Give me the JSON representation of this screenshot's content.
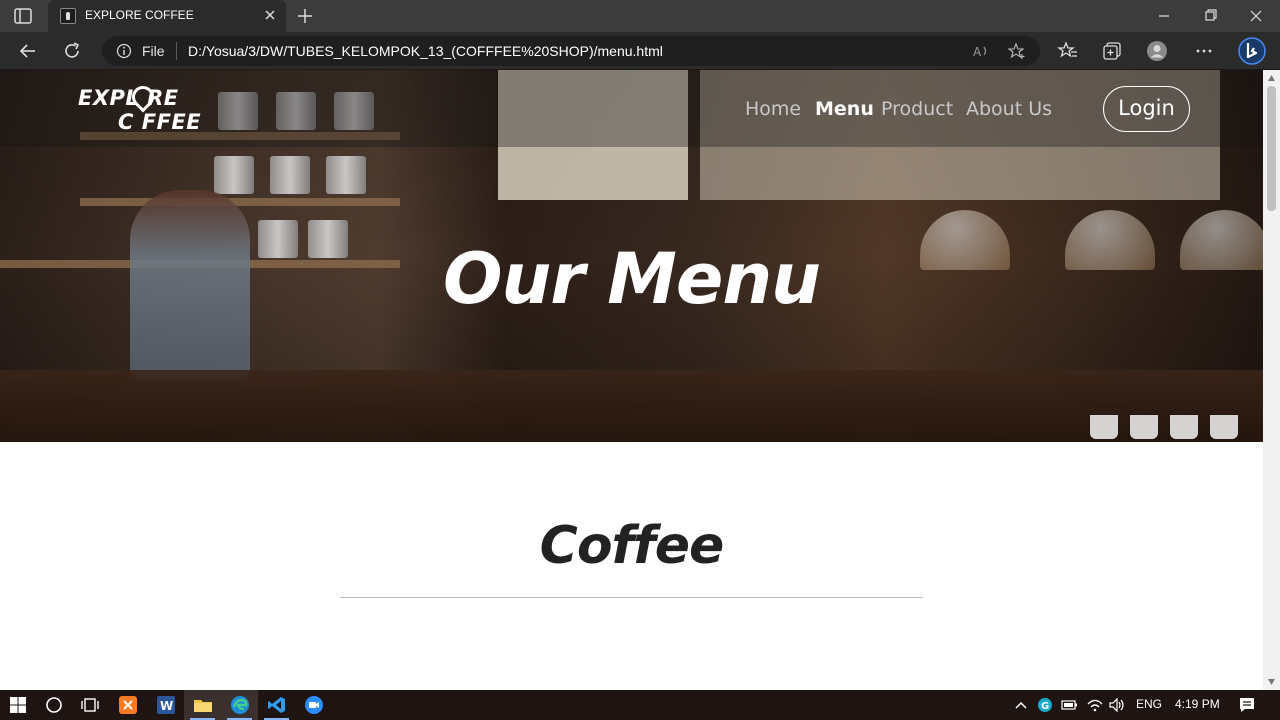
{
  "browser": {
    "tab_title": "EXPLORE COFFEE",
    "address": {
      "scheme_label": "File",
      "url": "D:/Yosua/3/DW/TUBES_KELOMPOK_13_(COFFFEE%20SHOP)/menu.html"
    }
  },
  "site": {
    "logo_line1": "EXPL RE",
    "logo_line2": "C FFEE",
    "nav": {
      "home": "Home",
      "menu": "Menu",
      "product": "Product",
      "about": "About Us"
    },
    "login_label": "Login",
    "hero_title": "Our Menu",
    "section_title": "Coffee"
  },
  "taskbar": {
    "language": "ENG",
    "time": "4:19 PM"
  },
  "colors": {
    "browser_chrome": "#2b2b2b",
    "tab_strip": "#3c3c3c",
    "nav_active": "#ffffff",
    "nav_inactive": "#c8c8c8",
    "taskbar": "#1e1412"
  }
}
